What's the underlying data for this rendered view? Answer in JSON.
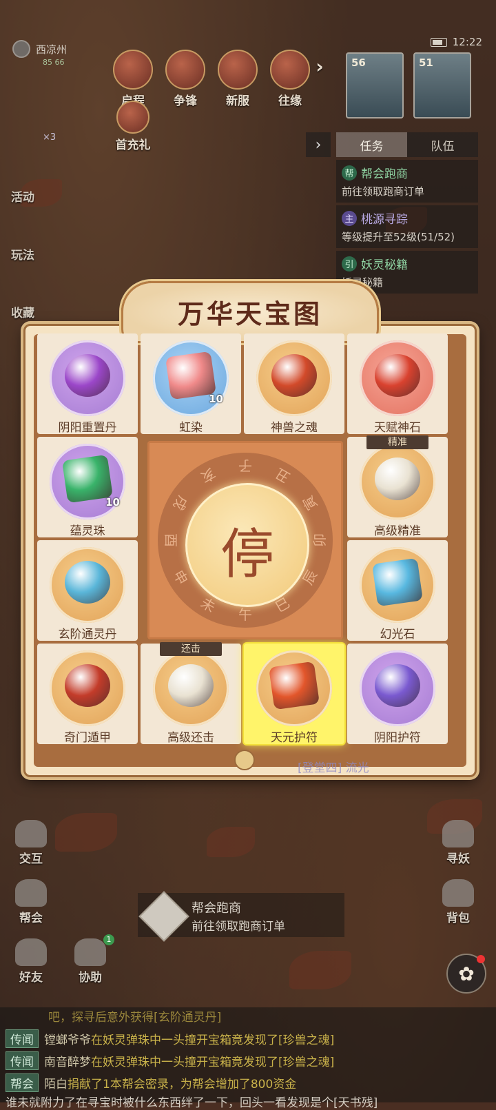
{
  "status": {
    "time": "12:22"
  },
  "location": {
    "name": "西凉州",
    "coords": "85 66"
  },
  "top_buttons": [
    {
      "label": "启程",
      "icon": "scroll-icon"
    },
    {
      "label": "争锋",
      "icon": "banner-icon"
    },
    {
      "label": "新服",
      "icon": "flower-icon"
    },
    {
      "label": "往缘",
      "icon": "gift-icon"
    }
  ],
  "first_charge": {
    "label": "首充礼"
  },
  "more_arrow": "›",
  "avatars": [
    {
      "level": "56"
    },
    {
      "level": "51"
    }
  ],
  "item_count": "×3",
  "task_panel": {
    "tabs": [
      "任务",
      "队伍"
    ],
    "tasks": [
      {
        "badge": "帮",
        "title": "帮会跑商",
        "desc": "前往领取跑商订单"
      },
      {
        "badge": "主",
        "title": "桃源寻踪",
        "desc": "等级提升至52级(51/52)"
      },
      {
        "badge": "引",
        "title": "妖灵秘籍",
        "desc": "妖灵秘籍"
      }
    ]
  },
  "left_side": [
    "活动",
    "玩法",
    "收藏"
  ],
  "modal": {
    "title": "万华天宝图",
    "center_button": "停",
    "earthly_branches": [
      "子",
      "丑",
      "寅",
      "卯",
      "辰",
      "巳",
      "午",
      "未",
      "申",
      "酉",
      "戌",
      "亥"
    ],
    "cells": [
      {
        "label": "阴阳重置丹",
        "color": "purple",
        "qty": ""
      },
      {
        "label": "虹染",
        "color": "blue",
        "qty": "10"
      },
      {
        "label": "神兽之魂",
        "color": "orange",
        "qty": ""
      },
      {
        "label": "天赋神石",
        "color": "red",
        "qty": ""
      },
      {
        "label": "蕴灵珠",
        "color": "purple",
        "qty": "10"
      },
      {
        "label": "高级精准",
        "color": "orange",
        "qty": "",
        "ribbon": "精准"
      },
      {
        "label": "玄阶通灵丹",
        "color": "orange",
        "qty": ""
      },
      {
        "label": "幻光石",
        "color": "orange",
        "qty": ""
      },
      {
        "label": "奇门遁甲",
        "color": "orange",
        "qty": ""
      },
      {
        "label": "高级还击",
        "color": "orange",
        "qty": "",
        "ribbon": "还击"
      },
      {
        "label": "天元护符",
        "color": "orange",
        "qty": "",
        "highlighted": true
      },
      {
        "label": "阴阳护符",
        "color": "purple",
        "qty": ""
      }
    ]
  },
  "under_modal_text": "[登堂四] 流光",
  "bottom_buttons": [
    {
      "label": "交互",
      "badge": ""
    },
    {
      "label": "帮会",
      "badge": ""
    },
    {
      "label": "好友",
      "badge": ""
    },
    {
      "label": "协助",
      "badge": "1"
    },
    {
      "label": "寻妖",
      "badge": ""
    },
    {
      "label": "背包",
      "badge": ""
    }
  ],
  "quest_tracker": {
    "title": "帮会跑商",
    "desc": "前往领取跑商订单"
  },
  "chat": {
    "faded_line": "吧，探寻后意外获得[玄阶通灵丹]",
    "lines": [
      {
        "tag": "传闻",
        "name": "镗螂爷爷",
        "text": "在妖灵弹珠中一头撞开宝箱竟发现了[珍兽之魂]"
      },
      {
        "tag": "传闻",
        "name": "南音醉梦",
        "text": "在妖灵弹珠中一头撞开宝箱竟发现了[珍兽之魂]"
      },
      {
        "tag": "帮会",
        "name": "陌白",
        "text": "捐献了1本帮会密录，为帮会增加了800资金"
      }
    ],
    "bottom_line": "谁未就附力了在寻宝时被什么东西绊了一下，回头一看发现是个[天书残]"
  }
}
